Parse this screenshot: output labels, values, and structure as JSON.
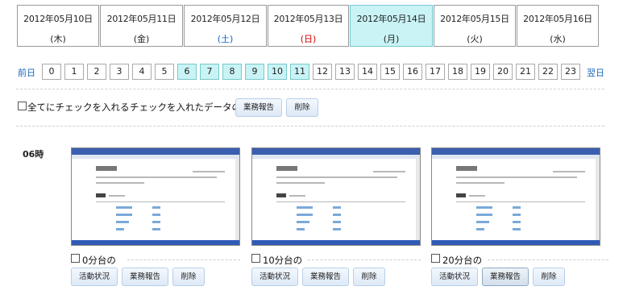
{
  "dates": [
    {
      "date": "2012年05月10日",
      "weekday": "(木)",
      "type": "normal",
      "selected": false
    },
    {
      "date": "2012年05月11日",
      "weekday": "(金)",
      "type": "normal",
      "selected": false
    },
    {
      "date": "2012年05月12日",
      "weekday": "(土)",
      "type": "sat",
      "selected": false
    },
    {
      "date": "2012年05月13日",
      "weekday": "(日)",
      "type": "sun",
      "selected": false
    },
    {
      "date": "2012年05月14日",
      "weekday": "(月)",
      "type": "normal",
      "selected": true
    },
    {
      "date": "2012年05月15日",
      "weekday": "(火)",
      "type": "normal",
      "selected": false
    },
    {
      "date": "2012年05月16日",
      "weekday": "(水)",
      "type": "normal",
      "selected": false
    }
  ],
  "hour_nav": {
    "prev": "前日",
    "next": "翌日",
    "hours": [
      "0",
      "1",
      "2",
      "3",
      "4",
      "5",
      "6",
      "7",
      "8",
      "9",
      "10",
      "11",
      "12",
      "13",
      "14",
      "15",
      "16",
      "17",
      "18",
      "19",
      "20",
      "21",
      "22",
      "23"
    ],
    "highlighted": [
      "6",
      "7",
      "8",
      "9",
      "10",
      "11"
    ]
  },
  "bulk": {
    "check_all_label": "全てにチェックを入れる",
    "checked_data_label": "チェックを入れたデータの",
    "report_button": "業務報告",
    "delete_button": "削除"
  },
  "hour_section": {
    "label": "06時",
    "captures": [
      {
        "label": "0分台の",
        "activity": "活動状況",
        "report": "業務報告",
        "delete": "削除"
      },
      {
        "label": "10分台の",
        "activity": "活動状況",
        "report": "業務報告",
        "delete": "削除"
      },
      {
        "label": "20分台の",
        "activity": "活動状況",
        "report": "業務報告",
        "delete": "削除"
      }
    ]
  }
}
